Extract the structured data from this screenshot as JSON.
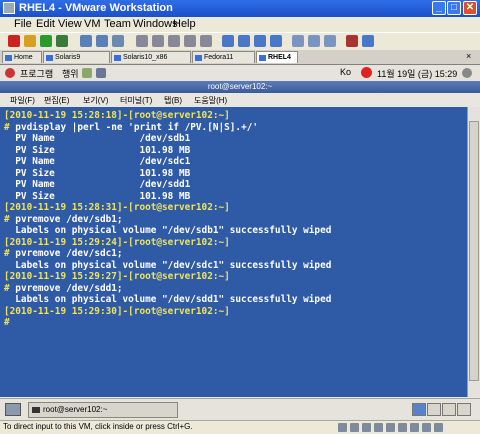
{
  "window": {
    "title": "RHEL4 - VMware Workstation"
  },
  "menubar": [
    "File",
    "Edit",
    "View",
    "VM",
    "Team",
    "Windows",
    "Help"
  ],
  "vm_tabs": [
    {
      "label": "Home",
      "active": false
    },
    {
      "label": "Solaris9",
      "active": false
    },
    {
      "label": "Solaris10_x86",
      "active": false
    },
    {
      "label": "Fedora11",
      "active": false
    },
    {
      "label": "RHEL4",
      "active": true
    }
  ],
  "tab_close": "×",
  "gnome_panel": {
    "applications": "프로그램",
    "actions": "행위",
    "input_method": "Ko",
    "datetime": "11월 19일 (금)  15:29"
  },
  "terminal": {
    "title": "root@server102:~",
    "menu": [
      "파일(F)",
      "편집(E)",
      "보기(V)",
      "터미널(T)",
      "탭(B)",
      "도움말(H)"
    ],
    "lines": [
      {
        "type": "prompt",
        "text": "[2010-11-19 15:28:18]-[root@server102:~]"
      },
      {
        "type": "cmd",
        "text": "# pvdisplay |perl -ne 'print if /PV.[N|S].+/'"
      },
      {
        "type": "out",
        "text": "  PV Name               /dev/sdb1"
      },
      {
        "type": "out",
        "text": "  PV Size               101.98 MB"
      },
      {
        "type": "out",
        "text": "  PV Name               /dev/sdc1"
      },
      {
        "type": "out",
        "text": "  PV Size               101.98 MB"
      },
      {
        "type": "out",
        "text": "  PV Name               /dev/sdd1"
      },
      {
        "type": "out",
        "text": "  PV Size               101.98 MB"
      },
      {
        "type": "prompt",
        "text": "[2010-11-19 15:28:31]-[root@server102:~]"
      },
      {
        "type": "cmd",
        "text": "# pvremove /dev/sdb1;"
      },
      {
        "type": "out",
        "text": "  Labels on physical volume \"/dev/sdb1\" successfully wiped"
      },
      {
        "type": "prompt",
        "text": "[2010-11-19 15:29:24]-[root@server102:~]"
      },
      {
        "type": "cmd",
        "text": "# pvremove /dev/sdc1;"
      },
      {
        "type": "out",
        "text": "  Labels on physical volume \"/dev/sdc1\" successfully wiped"
      },
      {
        "type": "prompt",
        "text": "[2010-11-19 15:29:27]-[root@server102:~]"
      },
      {
        "type": "cmd",
        "text": "# pvremove /dev/sdd1;"
      },
      {
        "type": "out",
        "text": "  Labels on physical volume \"/dev/sdd1\" successfully wiped"
      },
      {
        "type": "prompt",
        "text": "[2010-11-19 15:29:30]-[root@server102:~]"
      },
      {
        "type": "cursor",
        "text": "#"
      }
    ]
  },
  "taskbar": {
    "item": "root@server102:~"
  },
  "statusbar": {
    "message": "To direct input to this VM, click inside or press Ctrl+G."
  },
  "colors": {
    "terminal_bg": "#2e5aa6",
    "prompt": "#f0e45a",
    "text": "#ffffff"
  }
}
